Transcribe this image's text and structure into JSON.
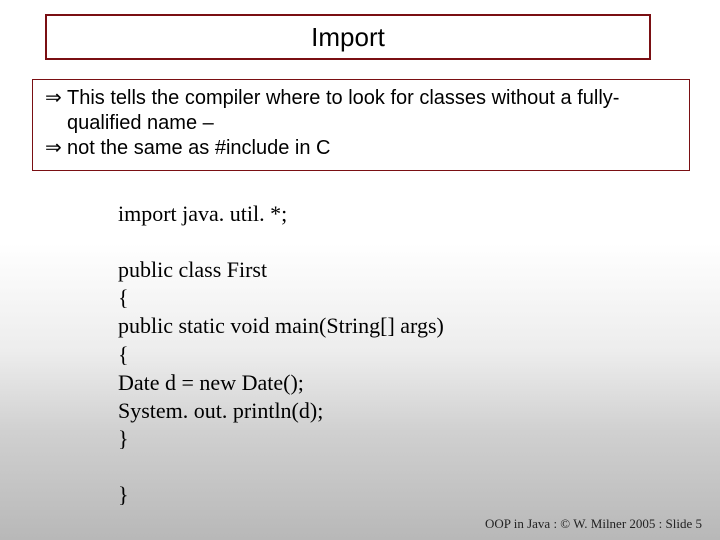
{
  "title": "Import",
  "bullets": [
    "This tells the compiler where to look for classes without a fully-qualified name –",
    "not the same as #include in C"
  ],
  "bullet_marker": "⇒",
  "code": {
    "l0": "import java. util. *;",
    "l1": "public class First",
    "l2": "{",
    "l3": "public static void main(String[] args)",
    "l4": "{",
    "l5": "Date d = new Date();",
    "l6": "System. out. println(d);",
    "l7": "}",
    "l8": "}"
  },
  "footer": "OOP in Java : © W. Milner 2005 : Slide 5"
}
